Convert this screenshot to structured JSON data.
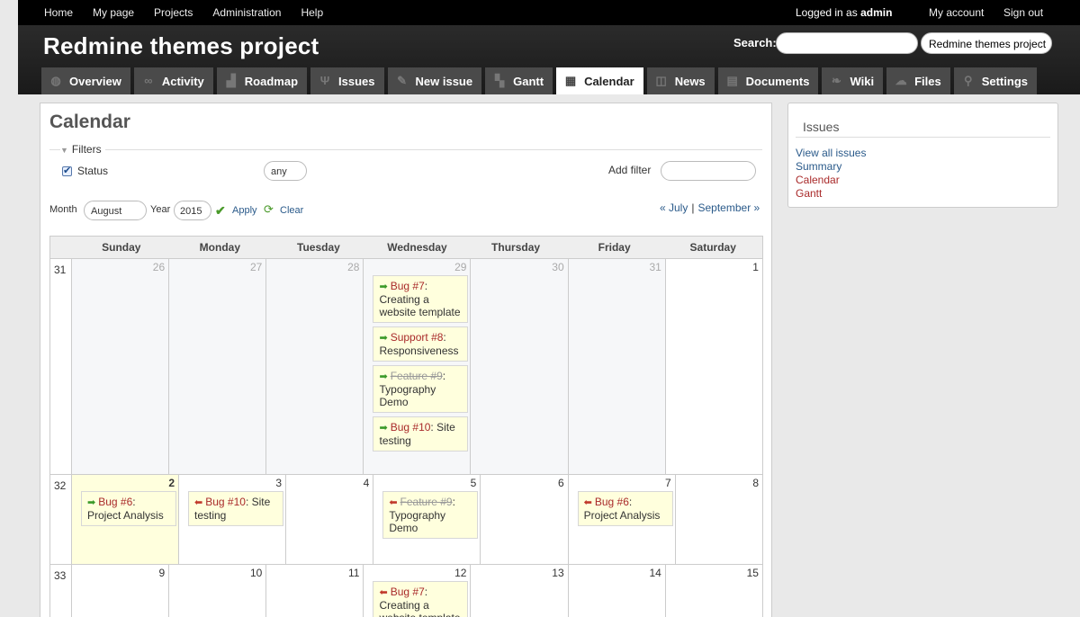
{
  "top_menu": {
    "items": [
      "Home",
      "My page",
      "Projects",
      "Administration",
      "Help"
    ],
    "logged_in_prefix": "Logged in as",
    "user": "admin",
    "my_account": "My account",
    "sign_out": "Sign out"
  },
  "header": {
    "title": "Redmine themes project",
    "search_label": "Search:",
    "search_value": "",
    "project_select": "Redmine themes project"
  },
  "main_menu": {
    "tabs": [
      {
        "label": "Overview",
        "icon": "globe-icon"
      },
      {
        "label": "Activity",
        "icon": "binoculars-icon"
      },
      {
        "label": "Roadmap",
        "icon": "roadmap-icon"
      },
      {
        "label": "Issues",
        "icon": "fork-icon"
      },
      {
        "label": "New issue",
        "icon": "pen-icon"
      },
      {
        "label": "Gantt",
        "icon": "gantt-icon"
      },
      {
        "label": "Calendar",
        "icon": "calendar-icon"
      },
      {
        "label": "News",
        "icon": "rss-icon"
      },
      {
        "label": "Documents",
        "icon": "documents-icon"
      },
      {
        "label": "Wiki",
        "icon": "wiki-icon"
      },
      {
        "label": "Files",
        "icon": "upload-icon"
      },
      {
        "label": "Settings",
        "icon": "plug-icon"
      }
    ],
    "selected": "Calendar"
  },
  "content": {
    "title": "Calendar",
    "filters_legend": "Filters",
    "status_label": "Status",
    "status_value": "any",
    "add_filter_label": "Add filter",
    "add_filter_value": "",
    "month_label": "Month",
    "month_value": "August",
    "year_label": "Year",
    "year_value": "2015",
    "apply": "Apply",
    "clear": "Clear",
    "prev": "« July",
    "sep": "|",
    "next": "September »"
  },
  "calendar": {
    "days": [
      "Sunday",
      "Monday",
      "Tuesday",
      "Wednesday",
      "Thursday",
      "Friday",
      "Saturday"
    ],
    "weeks": [
      {
        "num": "31",
        "cells": [
          {
            "d": "26",
            "odd": true,
            "issues": []
          },
          {
            "d": "27",
            "odd": true,
            "issues": []
          },
          {
            "d": "28",
            "odd": true,
            "issues": []
          },
          {
            "d": "29",
            "odd": true,
            "issues": [
              {
                "dir": "start",
                "ref": "Bug #7",
                "subject": "Creating a website template",
                "closed": false
              },
              {
                "dir": "start",
                "ref": "Support #8",
                "subject": "Responsiveness",
                "closed": false
              },
              {
                "dir": "start",
                "ref": "Feature #9",
                "subject": "Typography Demo",
                "closed": true
              },
              {
                "dir": "start",
                "ref": "Bug #10",
                "subject": "Site testing",
                "closed": false
              }
            ]
          },
          {
            "d": "30",
            "odd": true,
            "issues": []
          },
          {
            "d": "31",
            "odd": true,
            "issues": []
          },
          {
            "d": "1",
            "odd": false,
            "issues": []
          }
        ]
      },
      {
        "num": "32",
        "cells": [
          {
            "d": "2",
            "today": true,
            "issues": [
              {
                "dir": "start",
                "ref": "Bug #6",
                "subject": "Project Analysis",
                "closed": false
              }
            ]
          },
          {
            "d": "3",
            "issues": [
              {
                "dir": "end",
                "ref": "Bug #10",
                "subject": "Site testing",
                "closed": false
              }
            ]
          },
          {
            "d": "4",
            "issues": []
          },
          {
            "d": "5",
            "issues": [
              {
                "dir": "end",
                "ref": "Feature #9",
                "subject": "Typography Demo",
                "closed": true
              }
            ]
          },
          {
            "d": "6",
            "issues": []
          },
          {
            "d": "7",
            "issues": [
              {
                "dir": "end",
                "ref": "Bug #6",
                "subject": "Project Analysis",
                "closed": false
              }
            ]
          },
          {
            "d": "8",
            "issues": []
          }
        ]
      },
      {
        "num": "33",
        "cells": [
          {
            "d": "9",
            "issues": []
          },
          {
            "d": "10",
            "issues": []
          },
          {
            "d": "11",
            "issues": []
          },
          {
            "d": "12",
            "issues": [
              {
                "dir": "end",
                "ref": "Bug #7",
                "subject": "Creating a website template",
                "closed": false
              }
            ]
          },
          {
            "d": "13",
            "issues": []
          },
          {
            "d": "14",
            "issues": []
          },
          {
            "d": "15",
            "issues": []
          }
        ]
      }
    ]
  },
  "sidebar": {
    "title": "Issues",
    "links": [
      "View all issues",
      "Summary",
      "Calendar",
      "Gantt"
    ],
    "selected": [
      "Calendar",
      "Gantt"
    ]
  }
}
